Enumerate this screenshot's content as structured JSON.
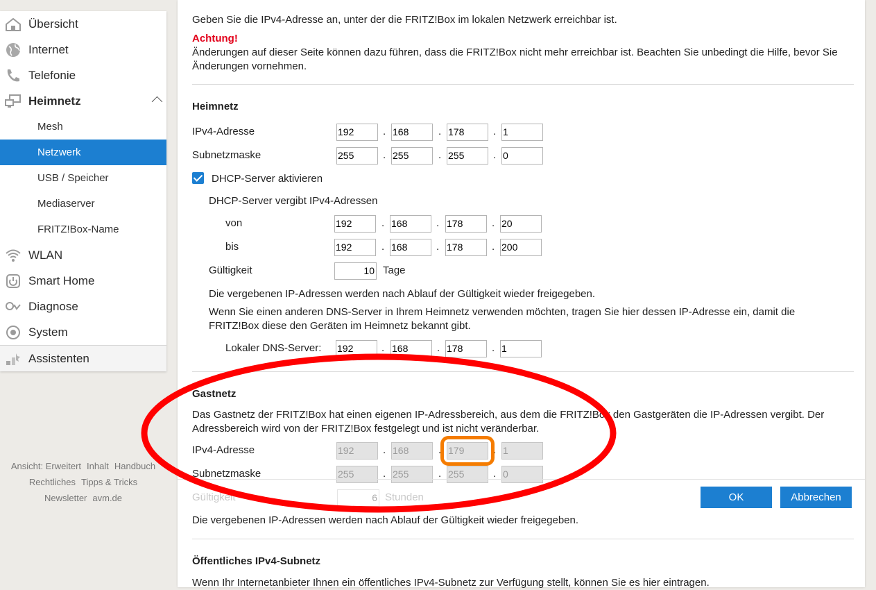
{
  "sidebar": {
    "items": [
      {
        "label": "Übersicht",
        "icon": "home-icon"
      },
      {
        "label": "Internet",
        "icon": "globe-icon"
      },
      {
        "label": "Telefonie",
        "icon": "phone-icon"
      },
      {
        "label": "Heimnetz",
        "icon": "network-icon"
      },
      {
        "label": "WLAN",
        "icon": "wifi-icon"
      },
      {
        "label": "Smart Home",
        "icon": "smart-home-icon"
      },
      {
        "label": "Diagnose",
        "icon": "diagnose-icon"
      },
      {
        "label": "System",
        "icon": "system-icon"
      },
      {
        "label": "Assistenten",
        "icon": "assistant-icon"
      }
    ],
    "sub_items": [
      "Mesh",
      "Netzwerk",
      "USB / Speicher",
      "Mediaserver",
      "FRITZ!Box-Name"
    ],
    "active_sub": "Netzwerk"
  },
  "footer": {
    "links": [
      "Ansicht: Erweitert",
      "Inhalt",
      "Handbuch",
      "Rechtliches",
      "Tipps & Tricks",
      "Newsletter",
      "avm.de"
    ]
  },
  "content": {
    "intro": "Geben Sie die IPv4-Adresse an, unter der die FRITZ!Box im lokalen Netzwerk erreichbar ist.",
    "warning_title": "Achtung!",
    "warning_text": "Änderungen auf dieser Seite können dazu führen, dass die FRITZ!Box nicht mehr erreichbar ist. Beachten Sie unbedingt die Hilfe, bevor Sie Änderungen vornehmen.",
    "heimnetz": {
      "title": "Heimnetz",
      "ipv4_label": "IPv4-Adresse",
      "ipv4": [
        "192",
        "168",
        "178",
        "1"
      ],
      "subnet_label": "Subnetzmaske",
      "subnet": [
        "255",
        "255",
        "255",
        "0"
      ],
      "dhcp_checkbox": "DHCP-Server aktivieren",
      "dhcp_range_label": "DHCP-Server vergibt IPv4-Adressen",
      "von_label": "von",
      "von": [
        "192",
        "168",
        "178",
        "20"
      ],
      "bis_label": "bis",
      "bis": [
        "192",
        "168",
        "178",
        "200"
      ],
      "validity_label": "Gültigkeit",
      "validity_value": "10",
      "validity_unit": "Tage",
      "validity_note": "Die vergebenen IP-Adressen werden nach Ablauf der Gültigkeit wieder freigegeben.",
      "dns_note": "Wenn Sie einen anderen DNS-Server in Ihrem Heimnetz verwenden möchten, tragen Sie hier dessen IP-Adresse ein, damit die FRITZ!Box diese den Geräten im Heimnetz bekannt gibt.",
      "dns_label": "Lokaler DNS-Server:",
      "dns": [
        "192",
        "168",
        "178",
        "1"
      ]
    },
    "gastnetz": {
      "title": "Gastnetz",
      "text": "Das Gastnetz der FRITZ!Box hat einen eigenen IP-Adressbereich, aus dem die FRITZ!Box den Gastgeräten die IP-Adressen vergibt. Der Adressbereich wird von der FRITZ!Box festgelegt und ist nicht veränderbar.",
      "ipv4_label": "IPv4-Adresse",
      "ipv4": [
        "192",
        "168",
        "179",
        "1"
      ],
      "subnet_label": "Subnetzmaske",
      "subnet": [
        "255",
        "255",
        "255",
        "0"
      ],
      "validity_label": "Gültigkeit",
      "validity_value": "6",
      "validity_unit": "Stunden",
      "validity_note": "Die vergebenen IP-Adressen werden nach Ablauf der Gültigkeit wieder freigegeben."
    },
    "public_subnet": {
      "title": "Öffentliches IPv4-Subnetz",
      "text": "Wenn Ihr Internetanbieter Ihnen ein öffentliches IPv4-Subnetz zur Verfügung stellt, können Sie es hier eintragen."
    },
    "buttons": {
      "ok": "OK",
      "cancel": "Abbrechen"
    }
  },
  "colors": {
    "accent": "#1c7fd1",
    "warning": "#e2001a",
    "annotation_ellipse": "#ff0000",
    "annotation_highlight": "#f57c00"
  }
}
